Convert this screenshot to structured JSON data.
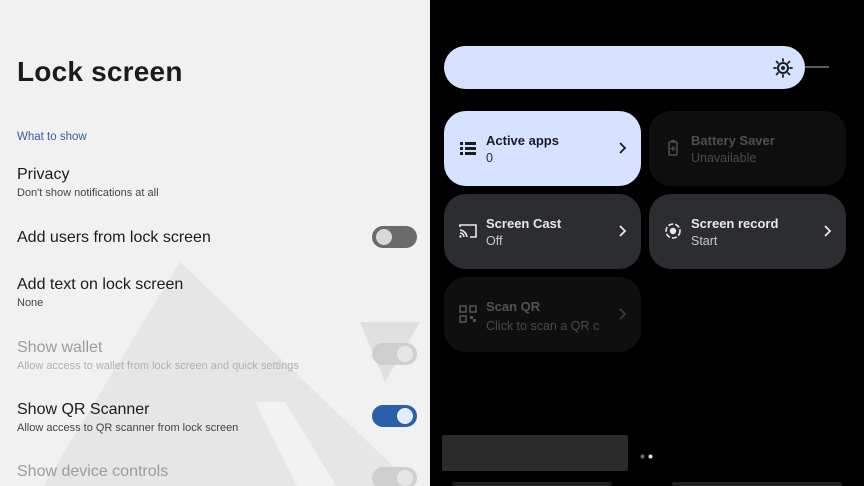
{
  "settings": {
    "title": "Lock screen",
    "section_label": "What to show",
    "rows": [
      {
        "title": "Privacy",
        "subtitle": "Don't show notifications at all"
      },
      {
        "title": "Add users from lock screen",
        "toggle": "off"
      },
      {
        "title": "Add text on lock screen",
        "subtitle": "None"
      },
      {
        "title": "Show wallet",
        "subtitle": "Allow access to wallet from lock screen and quick settings",
        "toggle": "disabled"
      },
      {
        "title": "Show QR Scanner",
        "subtitle": "Allow access to QR scanner from lock screen",
        "toggle": "on"
      },
      {
        "title": "Show device controls",
        "toggle": "disabled"
      }
    ]
  },
  "quick_settings": {
    "tiles": [
      {
        "label": "Active apps",
        "state": "0",
        "icon": "list-icon",
        "style": "active"
      },
      {
        "label": "Battery Saver",
        "state": "Unavailable",
        "icon": "battery-icon",
        "style": "unavailable"
      },
      {
        "label": "Screen Cast",
        "state": "Off",
        "icon": "cast-icon",
        "style": "normal"
      },
      {
        "label": "Screen record",
        "state": "Start",
        "icon": "record-icon",
        "style": "normal"
      },
      {
        "label": "Scan QR",
        "state": "Click to scan a QR code",
        "icon": "qr-icon",
        "style": "dim"
      }
    ],
    "brightness_icon": "brightness-icon",
    "page_indicator": {
      "pages": 2,
      "current": 2
    }
  },
  "colors": {
    "accent_blue": "#2d5fa8",
    "tile_active": "#d6e2ff",
    "tile_bg": "#2b2d30",
    "settings_bg": "#f1f1f1"
  }
}
